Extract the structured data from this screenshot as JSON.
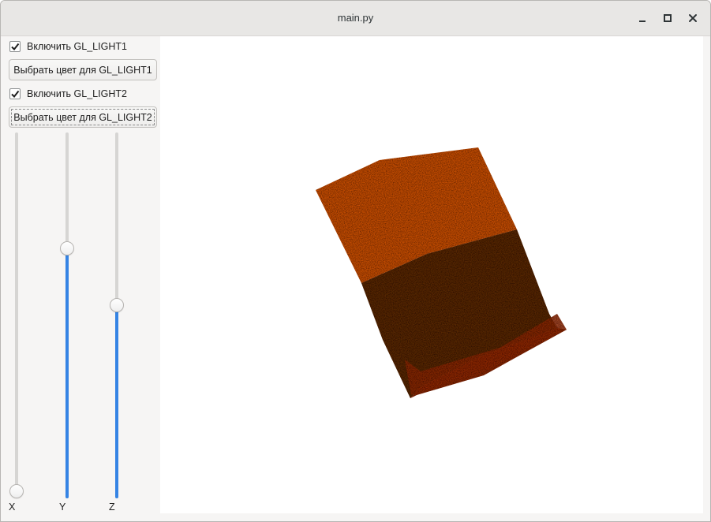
{
  "window": {
    "title": "main.py"
  },
  "title_controls": {
    "minimize_icon": "minimize-icon",
    "maximize_icon": "maximize-icon",
    "close_icon": "close-icon"
  },
  "sidebar": {
    "light1": {
      "checkbox_label": "Включить GL_LIGHT1",
      "checked": true,
      "color_button_label": "Выбрать цвет для GL_LIGHT1"
    },
    "light2": {
      "checkbox_label": "Включить GL_LIGHT2",
      "checked": true,
      "color_button_label": "Выбрать цвет для GL_LIGHT2"
    },
    "sliders": [
      {
        "label": "X",
        "value_fraction": 0.0
      },
      {
        "label": "Y",
        "value_fraction": 0.69
      },
      {
        "label": "Z",
        "value_fraction": 0.53
      }
    ]
  },
  "colors": {
    "accent": "#3584e4",
    "surface_top": "#c8500e",
    "surface_middle": "#5a2a0a",
    "surface_bottom": "#8a2a0a"
  }
}
